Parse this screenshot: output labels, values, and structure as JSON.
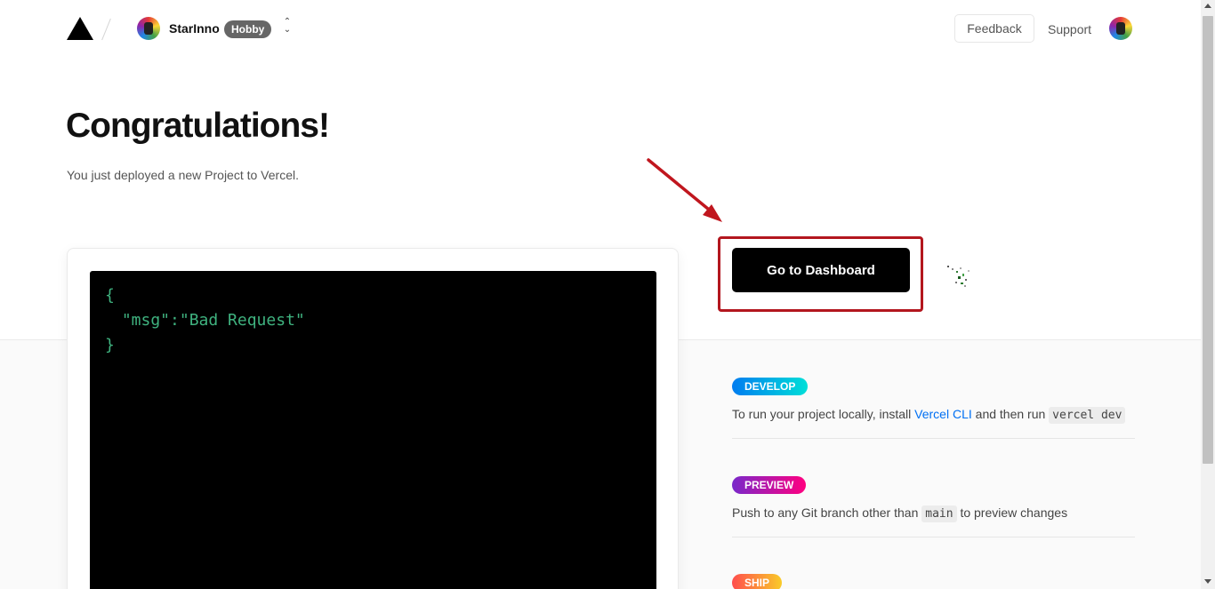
{
  "header": {
    "logo_icon": "vercel-triangle-icon",
    "team_name": "StarInno",
    "plan_badge": "Hobby",
    "feedback_label": "Feedback",
    "support_label": "Support"
  },
  "hero": {
    "title": "Congratulations!",
    "subtitle": "You just deployed a new Project to Vercel."
  },
  "preview": {
    "code_lines": [
      "{",
      " \"msg\":\"Bad Request\"",
      "}"
    ]
  },
  "actions": {
    "dashboard_label": "Go to Dashboard",
    "highlight_color": "#b3161e"
  },
  "steps": [
    {
      "badge": "DEVELOP",
      "text_before": "To run your project locally, install ",
      "link": "Vercel CLI",
      "text_middle": " and then run ",
      "code": "vercel dev",
      "text_after": ""
    },
    {
      "badge": "PREVIEW",
      "text_before": "Push to any Git branch other than ",
      "code": "main",
      "text_after": " to preview changes"
    },
    {
      "badge": "SHIP"
    }
  ],
  "colors": {
    "accent_link": "#0070f3",
    "develop_gradient": [
      "#007cf0",
      "#00dfd8"
    ],
    "preview_gradient": [
      "#7928ca",
      "#ff0080"
    ],
    "ship_gradient": [
      "#ff4d4d",
      "#f9cb28"
    ],
    "code_text": "#3fb27f"
  }
}
